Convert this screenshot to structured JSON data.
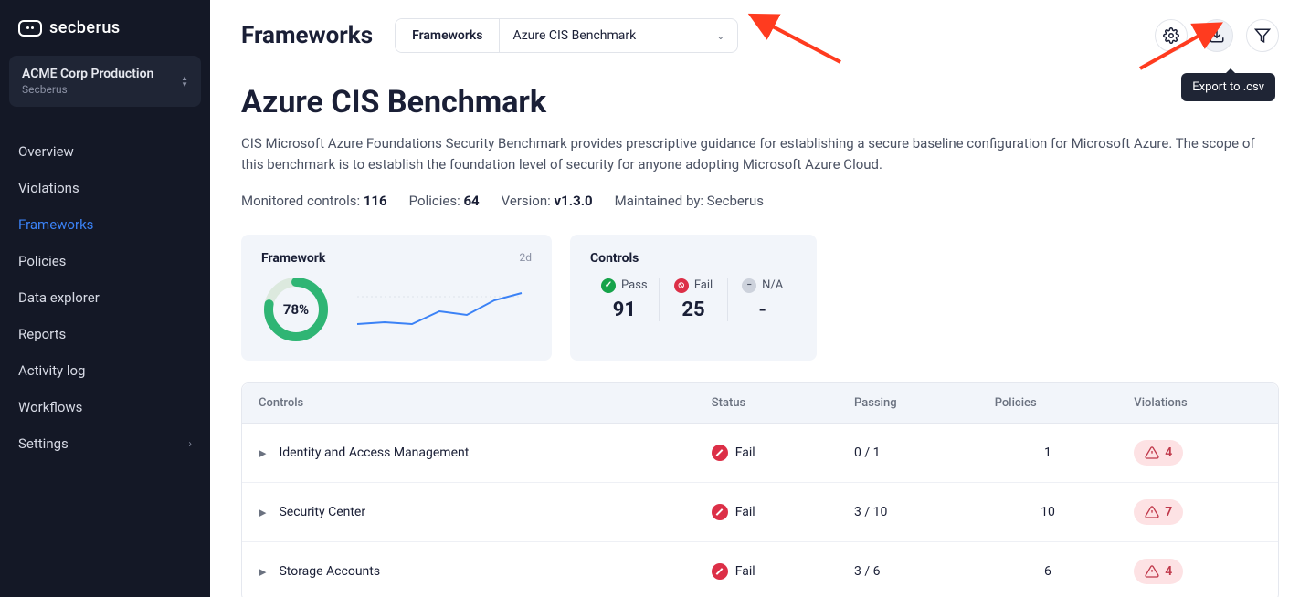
{
  "brand": "secberus",
  "org": {
    "name": "ACME Corp Production",
    "sub": "Secberus"
  },
  "nav": {
    "items": [
      "Overview",
      "Violations",
      "Frameworks",
      "Policies",
      "Data explorer",
      "Reports",
      "Activity log",
      "Workflows",
      "Settings"
    ],
    "active": "Frameworks"
  },
  "header": {
    "title": "Frameworks",
    "seg_label": "Frameworks",
    "selected": "Azure CIS Benchmark",
    "tooltip": "Export to .csv"
  },
  "hero": {
    "title": "Azure CIS Benchmark",
    "desc": "CIS Microsoft Azure Foundations Security Benchmark provides prescriptive guidance for establishing a secure baseline configuration for Microsoft Azure. The scope of this benchmark is to establish the foundation level of security for anyone adopting Microsoft Azure Cloud."
  },
  "meta": {
    "monitored_label": "Monitored controls:",
    "monitored_val": "116",
    "policies_label": "Policies:",
    "policies_val": "64",
    "version_label": "Version:",
    "version_val": "v1.3.0",
    "maintained_label": "Maintained by:",
    "maintained_val": "Secberus"
  },
  "cards": {
    "framework": {
      "title": "Framework",
      "time": "2d",
      "pct": "78%"
    },
    "controls": {
      "title": "Controls",
      "pass_label": "Pass",
      "pass_val": "91",
      "fail_label": "Fail",
      "fail_val": "25",
      "na_label": "N/A",
      "na_val": "-"
    }
  },
  "table": {
    "headers": [
      "Controls",
      "Status",
      "Passing",
      "Policies",
      "Violations"
    ],
    "rows": [
      {
        "name": "Identity and Access Management",
        "status": "Fail",
        "passing": "0 / 1",
        "policies": "1",
        "violations": "4"
      },
      {
        "name": "Security Center",
        "status": "Fail",
        "passing": "3 / 10",
        "policies": "10",
        "violations": "7"
      },
      {
        "name": "Storage Accounts",
        "status": "Fail",
        "passing": "3 / 6",
        "policies": "6",
        "violations": "4"
      }
    ]
  },
  "chart_data": {
    "donut": {
      "type": "pie",
      "values": [
        78,
        22
      ],
      "title": "Framework score",
      "unit": "%"
    },
    "sparkline": {
      "type": "line",
      "x": [
        0,
        1,
        2,
        3,
        4,
        5,
        6
      ],
      "values": [
        30,
        32,
        30,
        48,
        42,
        60,
        68
      ],
      "ylim": [
        0,
        100
      ]
    }
  }
}
